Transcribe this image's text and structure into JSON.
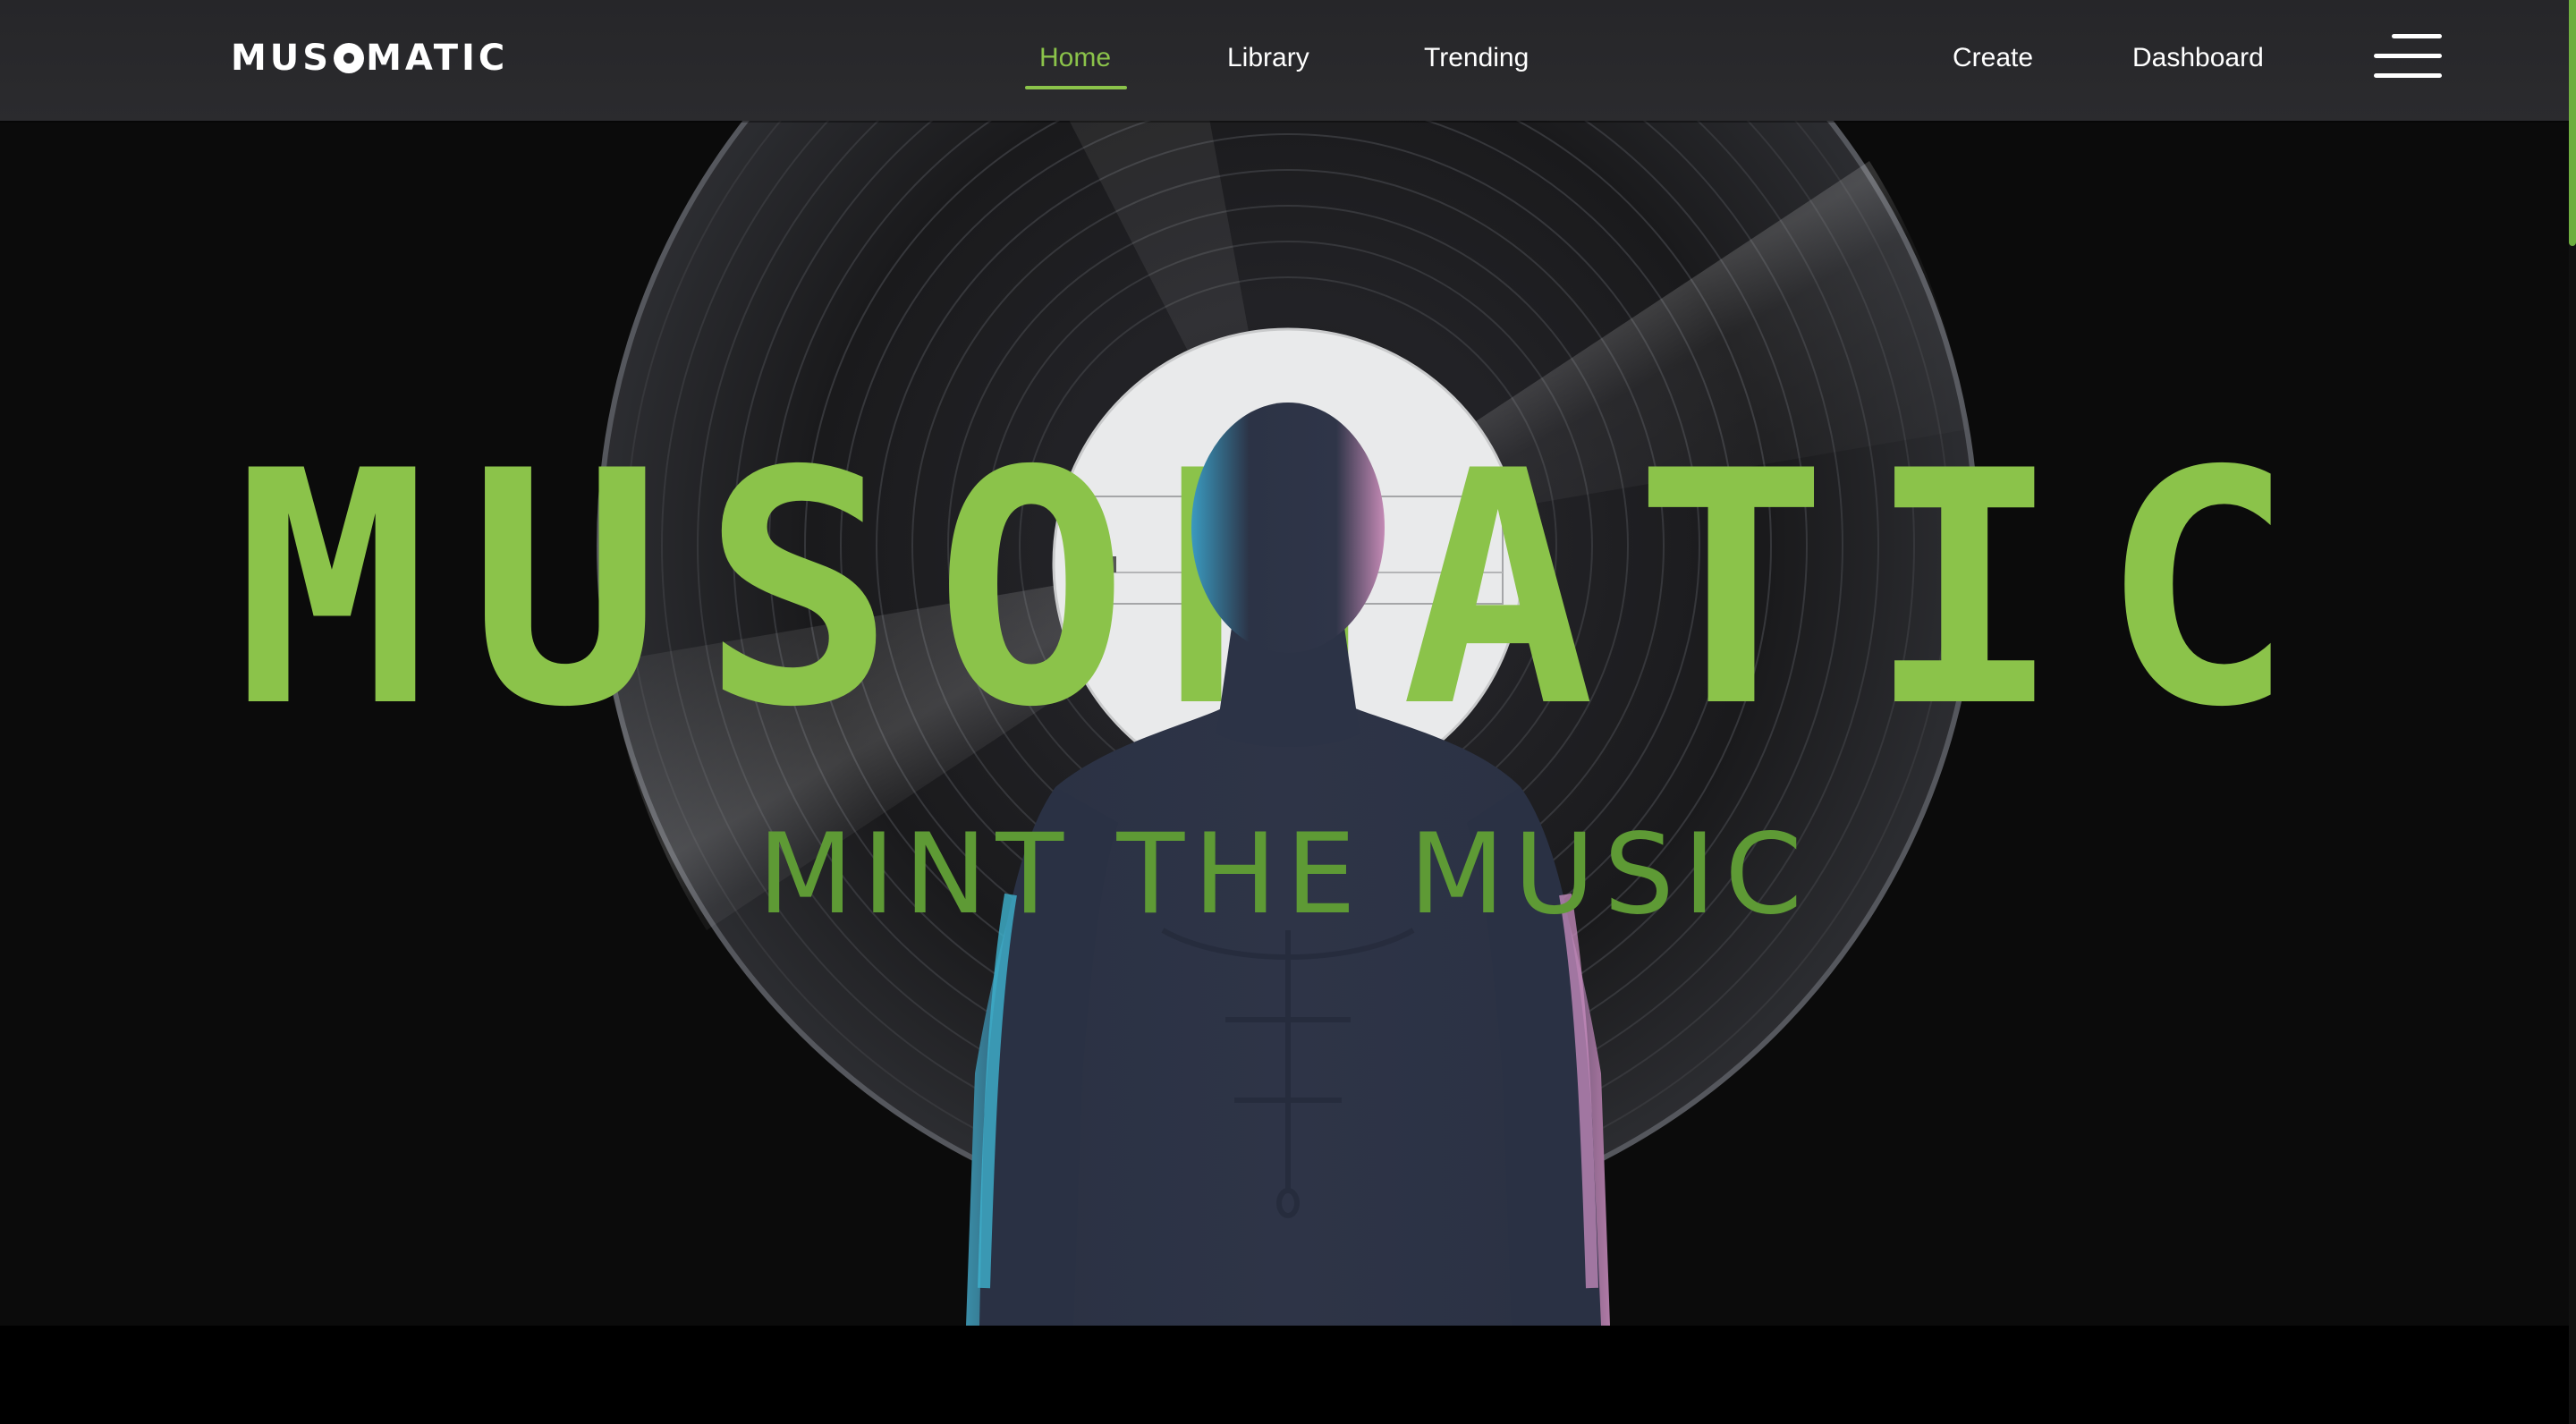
{
  "nav": {
    "logo_left": "MUS",
    "logo_right": "MATIC",
    "links": [
      {
        "label": "Home",
        "active": true
      },
      {
        "label": "Library",
        "active": false
      },
      {
        "label": "Trending",
        "active": false
      }
    ],
    "right_links": [
      {
        "label": "Create"
      },
      {
        "label": "Dashboard"
      }
    ]
  },
  "hero": {
    "title": "MUSOMATIC",
    "tagline": "MINT THE MUSIC"
  },
  "theme": {
    "accent": "#8bc34a",
    "nav_bg": "#2a2a2d",
    "hero_bg": "#0b0b0b"
  }
}
